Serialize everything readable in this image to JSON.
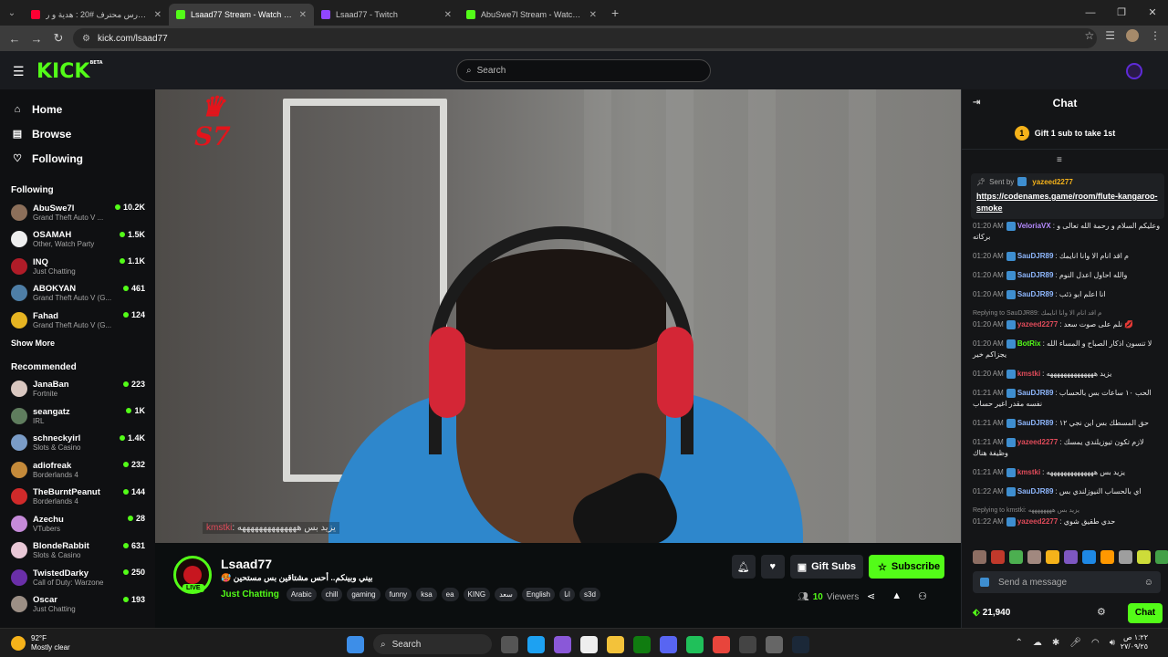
{
  "browser": {
    "tabs": [
      {
        "title": "حلم حارس محترف #20 : هدية و ر",
        "color": "#ff0033",
        "active": false
      },
      {
        "title": "Lsaad77 Stream - Watch Live o",
        "color": "#53fc18",
        "active": true
      },
      {
        "title": "Lsaad77 - Twitch",
        "color": "#9146ff",
        "active": false
      },
      {
        "title": "AbuSwe7l Stream - Watch Live",
        "color": "#53fc18",
        "active": false
      }
    ],
    "url": "kick.com/lsaad77"
  },
  "header": {
    "logo": "KICK",
    "logo_sup": "BETA",
    "search_placeholder": "Search"
  },
  "sidebar": {
    "nav": [
      {
        "label": "Home",
        "icon": "home-icon"
      },
      {
        "label": "Browse",
        "icon": "browse-icon"
      },
      {
        "label": "Following",
        "icon": "heart-icon"
      }
    ],
    "following_title": "Following",
    "following": [
      {
        "name": "AbuSwe7l",
        "category": "Grand Theft Auto V ...",
        "viewers": "10.2K",
        "color": "#8c6f5a"
      },
      {
        "name": "OSAMAH",
        "category": "Other, Watch Party",
        "viewers": "1.5K",
        "color": "#eee"
      },
      {
        "name": "INQ",
        "category": "Just Chatting",
        "viewers": "1.1K",
        "color": "#b01c28"
      },
      {
        "name": "ABOKYAN",
        "category": "Grand Theft Auto V (G...",
        "viewers": "461",
        "color": "#4e7ea6"
      },
      {
        "name": "Fahad",
        "category": "Grand Theft Auto V (G...",
        "viewers": "124",
        "color": "#e6b422"
      }
    ],
    "show_more": "Show More",
    "recommended_title": "Recommended",
    "recommended": [
      {
        "name": "JanaBan",
        "category": "Fortnite",
        "viewers": "223",
        "color": "#d9c7c0"
      },
      {
        "name": "seangatz",
        "category": "IRL",
        "viewers": "1K",
        "color": "#5f7d5e"
      },
      {
        "name": "schneckyirl",
        "category": "Slots & Casino",
        "viewers": "1.4K",
        "color": "#7a9cc7"
      },
      {
        "name": "adiofreak",
        "category": "Borderlands 4",
        "viewers": "232",
        "color": "#c48a3a"
      },
      {
        "name": "TheBurntPeanut",
        "category": "Borderlands 4",
        "viewers": "144",
        "color": "#d02a2a"
      },
      {
        "name": "Azechu",
        "category": "VTubers",
        "viewers": "28",
        "color": "#c58ad9"
      },
      {
        "name": "BlondeRabbit",
        "category": "Slots & Casino",
        "viewers": "631",
        "color": "#e8c7d6"
      },
      {
        "name": "TwistedDarky",
        "category": "Call of Duty: Warzone",
        "viewers": "250",
        "color": "#6a2fa8"
      },
      {
        "name": "Oscar",
        "category": "Just Chatting",
        "viewers": "193",
        "color": "#9c8f85"
      }
    ]
  },
  "video": {
    "logo_text": "S7",
    "overlay_user": "kmstki",
    "overlay_msg": ": يزيد بس ههههههههههههههه"
  },
  "stream": {
    "channel": "Lsaad77",
    "live_label": "LIVE",
    "title": "🥵 بيني وبينكم.. أحس مشتاقين بس مستحين",
    "category": "Just Chatting",
    "tags": [
      "Arabic",
      "chill",
      "gaming",
      "funny",
      "ksa",
      "ea",
      "KING",
      "سعد",
      "English",
      "انا",
      "s3d"
    ],
    "gift_label": "Gift Subs",
    "subscribe_label": "Subscribe",
    "viewers_count": "10",
    "viewers_label": "Viewers"
  },
  "chat": {
    "title": "Chat",
    "gift_banner": "Gift 1 sub to take 1st",
    "gift_num": "1",
    "pinned_sent_by": "Sent by",
    "pinned_user": "yazeed2277",
    "pinned_link": "https://codenames.game/room/flute-kangaroo-smoke",
    "messages": [
      {
        "time": "01:20 AM",
        "user": "VeloriaVX",
        "color": "#b58aff",
        "text": ": وعليكم السلام و رحمة الله تعالى و بركاته",
        "reply": ""
      },
      {
        "time": "01:20 AM",
        "user": "SauDJR89",
        "color": "#8fb8ff",
        "text": ": م اقد انام الا وانا انايمك",
        "reply": ""
      },
      {
        "time": "01:20 AM",
        "user": "SauDJR89",
        "color": "#8fb8ff",
        "text": ": والله احاول اعدل النوم",
        "reply": ""
      },
      {
        "time": "01:20 AM",
        "user": "SauDJR89",
        "color": "#8fb8ff",
        "text": ": انا اعلم ابو ذئب",
        "reply": ""
      },
      {
        "time": "01:20 AM",
        "user": "yazeed2277",
        "color": "#e04b5a",
        "text": ": نلم على صوت سعد 💋",
        "reply": "Replying to SauDJR89: م اقد انام الا وانا انايمك"
      },
      {
        "time": "01:20 AM",
        "user": "BotRix",
        "color": "#53fc18",
        "text": ": لا تنسون اذكار الصباح و المساء الله يجزاكم خير",
        "reply": ""
      },
      {
        "time": "01:20 AM",
        "user": "kmstki",
        "color": "#e04b5a",
        "text": ": يزيد ههههههههههههههه",
        "reply": ""
      },
      {
        "time": "01:21 AM",
        "user": "SauDJR89",
        "color": "#8fb8ff",
        "text": ": الحب ١٠ ساعات بس بالحساب نفسه مقدر اغير حساب",
        "reply": ""
      },
      {
        "time": "01:21 AM",
        "user": "SauDJR89",
        "color": "#8fb8ff",
        "text": ": حق المسطك بس اين نجي ١٢",
        "reply": ""
      },
      {
        "time": "01:21 AM",
        "user": "yazeed2277",
        "color": "#e04b5a",
        "text": ": لازم تكون تيوزيلندي يمسك وظيفة هناك",
        "reply": ""
      },
      {
        "time": "01:21 AM",
        "user": "kmstki",
        "color": "#e04b5a",
        "text": ": يزيد بس ههههههههههههههه",
        "reply": ""
      },
      {
        "time": "01:22 AM",
        "user": "SauDJR89",
        "color": "#8fb8ff",
        "text": ": اي بالحساب النيوزلندي بس",
        "reply": ""
      },
      {
        "time": "01:22 AM",
        "user": "yazeed2277",
        "color": "#e04b5a",
        "text": ": حدي طقيق شوي",
        "reply": "Replying to kmstki: يزيد بس ههههههههه"
      }
    ],
    "send_placeholder": "Send a message",
    "points": "21,940",
    "chat_button": "Chat"
  },
  "taskbar": {
    "temp": "92°F",
    "weather": "Mostly clear",
    "search": "Search",
    "time": "١:٢٢ ص",
    "date": "٢٧/٠٩/٢٥"
  }
}
